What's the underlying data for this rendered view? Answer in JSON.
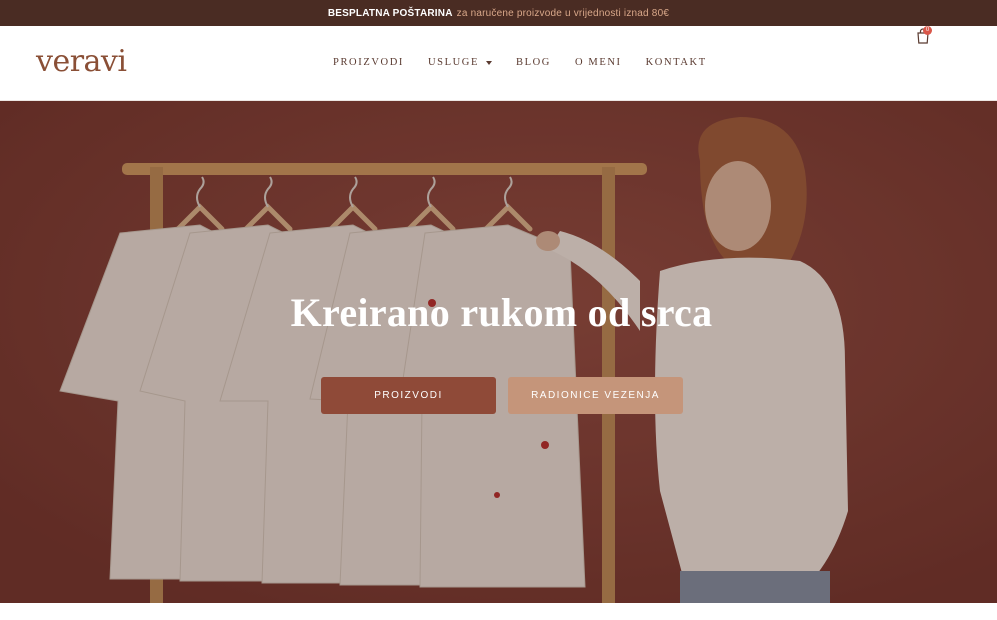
{
  "announcement": {
    "strong": "BESPLATNA POŠTARINA",
    "rest": "za naručene proizvode u vrijednosti iznad 80€"
  },
  "header": {
    "logo": "veravi",
    "nav": [
      {
        "label": "PROIZVODI",
        "has_dropdown": false
      },
      {
        "label": "USLUGE",
        "has_dropdown": true
      },
      {
        "label": "BLOG",
        "has_dropdown": false
      },
      {
        "label": "O MENI",
        "has_dropdown": false
      },
      {
        "label": "KONTAKT",
        "has_dropdown": false
      }
    ],
    "cart": {
      "icon": "shopping-bag-icon",
      "count": "0"
    }
  },
  "hero": {
    "title": "Kreirano rukom od srca",
    "buttons": {
      "primary": "PROIZVODI",
      "secondary": "RADIONICE VEZENJA"
    },
    "image_description_colors": {
      "wall": "#7b3a32",
      "shirts": "#e8e2da",
      "rack": "#c99a62"
    }
  },
  "colors": {
    "topbar": "#4a2c23",
    "accent_text": "#d9a88a",
    "logo": "#8a4f36",
    "primary_button": "#8f4a38",
    "secondary_button": "#c5957a"
  }
}
